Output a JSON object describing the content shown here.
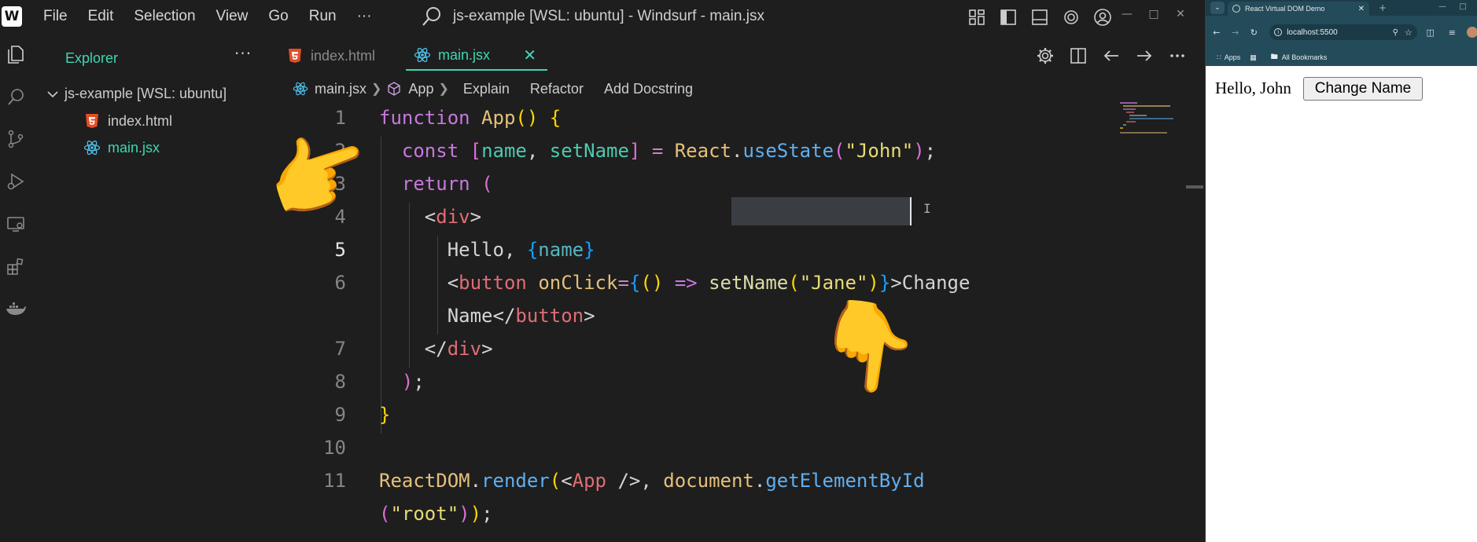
{
  "ide": {
    "menu": [
      "File",
      "Edit",
      "Selection",
      "View",
      "Go",
      "Run",
      "···"
    ],
    "window_title": "js-example [WSL: ubuntu] - Windsurf - main.jsx",
    "explorer": {
      "title": "Explorer",
      "more": "···",
      "folder": "js-example [WSL: ubuntu]",
      "files": [
        "index.html",
        "main.jsx"
      ]
    },
    "tabs": [
      {
        "label": "index.html",
        "active": false
      },
      {
        "label": "main.jsx",
        "active": true
      }
    ],
    "tab_close": "✕",
    "breadcrumb": {
      "file": "main.jsx",
      "symbol": "App",
      "lenses": [
        "Explain",
        "Refactor",
        "Add Docstring"
      ]
    },
    "gutter": [
      "1",
      "2",
      "3",
      "4",
      "5",
      "6",
      "",
      "7",
      "8",
      "9",
      "10",
      "11",
      ""
    ],
    "active_line": "5",
    "emoji": {
      "point_left": "👉",
      "point_down": "👇"
    },
    "accent_color": "#3fd6b3"
  },
  "browser": {
    "tab_title": "React Virtual DOM Demo",
    "url": "localhost:5500",
    "bookmarks": {
      "apps": "Apps",
      "folder": "All Bookmarks"
    },
    "page": {
      "greeting": "Hello, John",
      "button_label": "Change Name"
    }
  }
}
